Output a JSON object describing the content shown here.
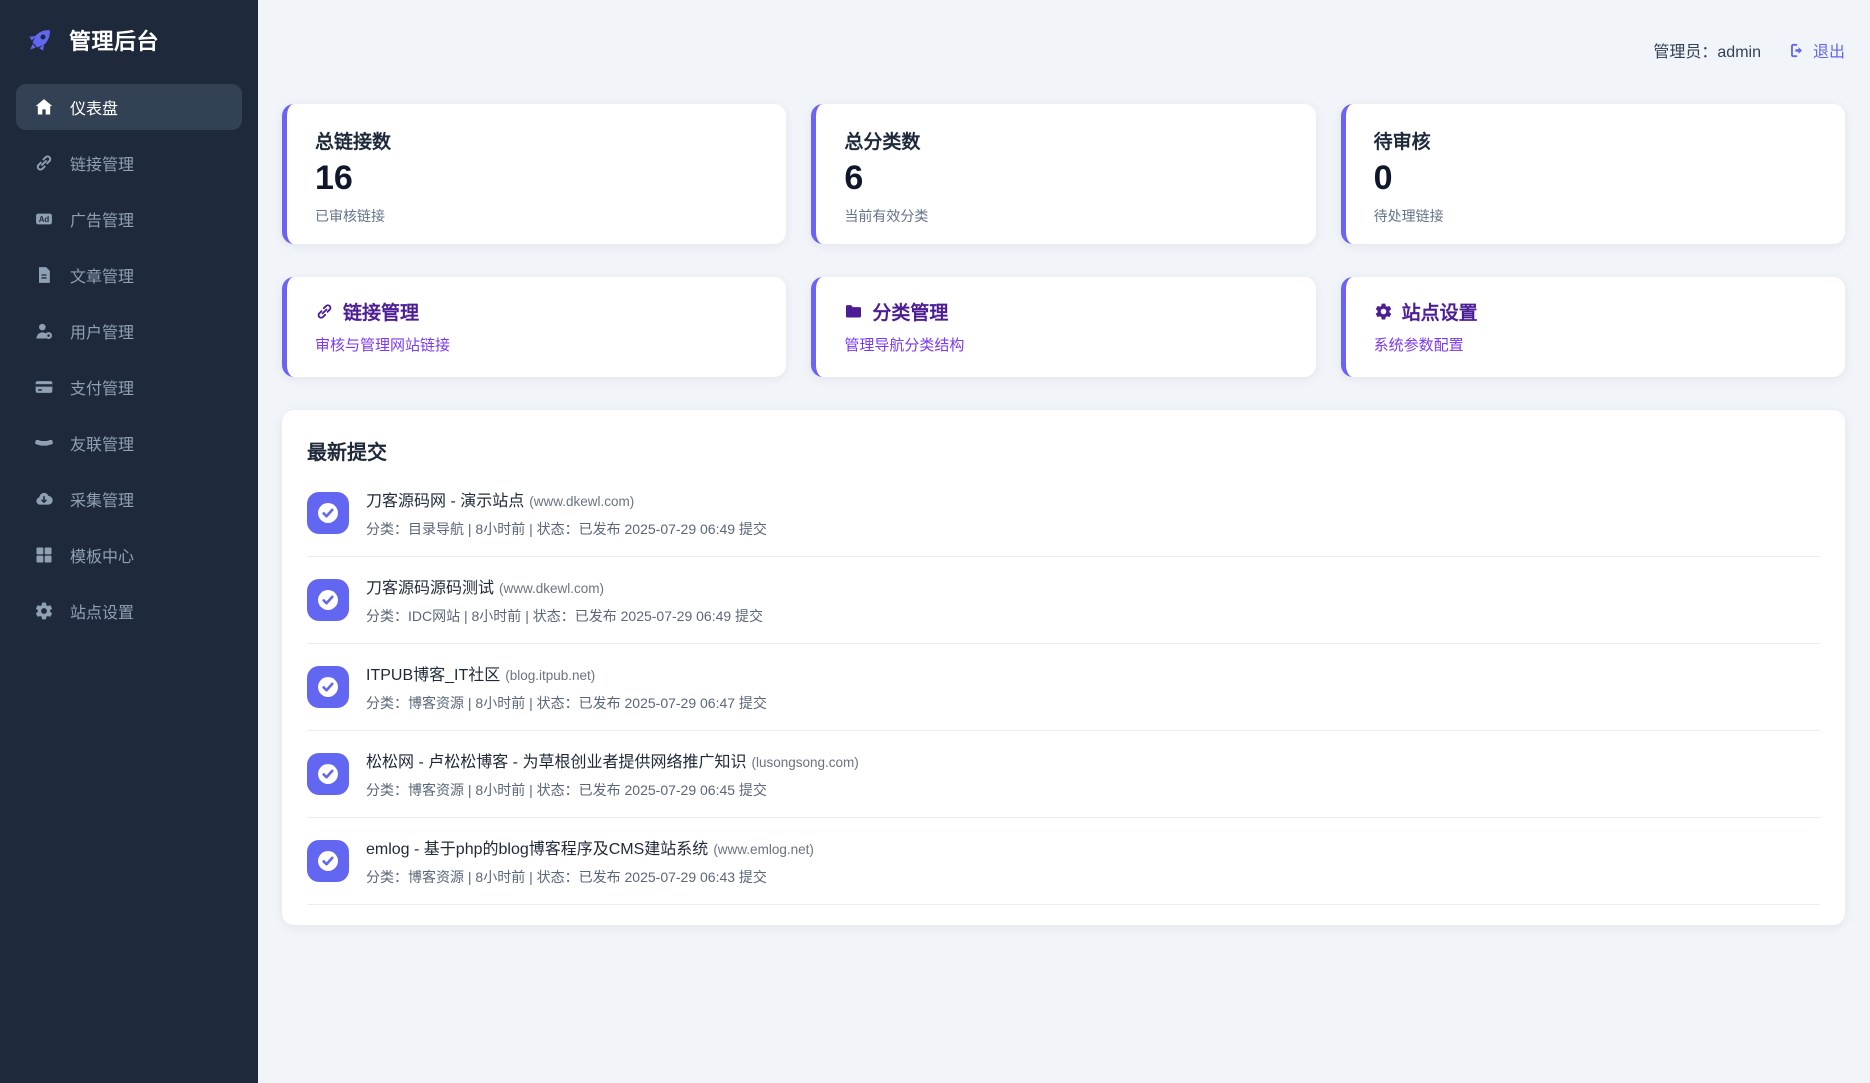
{
  "app": {
    "title": "管理后台"
  },
  "header": {
    "admin_label": "管理员：",
    "admin_name": "admin",
    "logout_label": "退出"
  },
  "sidebar": {
    "items": [
      {
        "label": "仪表盘",
        "icon": "home-icon",
        "active": true
      },
      {
        "label": "链接管理",
        "icon": "link-icon",
        "active": false
      },
      {
        "label": "广告管理",
        "icon": "ad-icon",
        "active": false
      },
      {
        "label": "文章管理",
        "icon": "article-icon",
        "active": false
      },
      {
        "label": "用户管理",
        "icon": "user-gear-icon",
        "active": false
      },
      {
        "label": "支付管理",
        "icon": "credit-card-icon",
        "active": false
      },
      {
        "label": "友联管理",
        "icon": "handshake-icon",
        "active": false
      },
      {
        "label": "采集管理",
        "icon": "cloud-download-icon",
        "active": false
      },
      {
        "label": "模板中心",
        "icon": "grid-icon",
        "active": false
      },
      {
        "label": "站点设置",
        "icon": "gear-icon",
        "active": false
      }
    ]
  },
  "stats": {
    "cards": [
      {
        "title": "总链接数",
        "value": "16",
        "subtitle": "已审核链接"
      },
      {
        "title": "总分类数",
        "value": "6",
        "subtitle": "当前有效分类"
      },
      {
        "title": "待审核",
        "value": "0",
        "subtitle": "待处理链接"
      }
    ]
  },
  "quick_actions": {
    "cards": [
      {
        "title": "链接管理",
        "subtitle": "审核与管理网站链接",
        "icon": "link-icon"
      },
      {
        "title": "分类管理",
        "subtitle": "管理导航分类结构",
        "icon": "folder-icon"
      },
      {
        "title": "站点设置",
        "subtitle": "系统参数配置",
        "icon": "gear-icon"
      }
    ]
  },
  "latest": {
    "title": "最新提交",
    "items": [
      {
        "name": "刀客源码网 - 演示站点",
        "domain": "(www.dkewl.com)",
        "meta": "分类：目录导航 | 8小时前 | 状态：已发布 2025-07-29 06:49 提交"
      },
      {
        "name": "刀客源码源码测试",
        "domain": "(www.dkewl.com)",
        "meta": "分类：IDC网站 | 8小时前 | 状态：已发布 2025-07-29 06:49 提交"
      },
      {
        "name": "ITPUB博客_IT社区",
        "domain": "(blog.itpub.net)",
        "meta": "分类：博客资源 | 8小时前 | 状态：已发布 2025-07-29 06:47 提交"
      },
      {
        "name": "松松网 - 卢松松博客 - 为草根创业者提供网络推广知识",
        "domain": "(lusongsong.com)",
        "meta": "分类：博客资源 | 8小时前 | 状态：已发布 2025-07-29 06:45 提交"
      },
      {
        "name": "emlog - 基于php的blog博客程序及CMS建站系统",
        "domain": "(www.emlog.net)",
        "meta": "分类：博客资源 | 8小时前 | 状态：已发布 2025-07-29 06:43 提交"
      }
    ]
  },
  "colors": {
    "accent": "#6366f1",
    "card_accent_border": "#6d63f2",
    "sidebar_bg": "#1e293b",
    "sidebar_active_bg": "#334155",
    "sidebar_text": "#8fa0b5",
    "page_bg": "#f1f5f9",
    "quick_title": "#4c1d95",
    "quick_subtitle": "#7c3aed",
    "text_primary": "#1e293b",
    "text_muted": "#64748b"
  }
}
